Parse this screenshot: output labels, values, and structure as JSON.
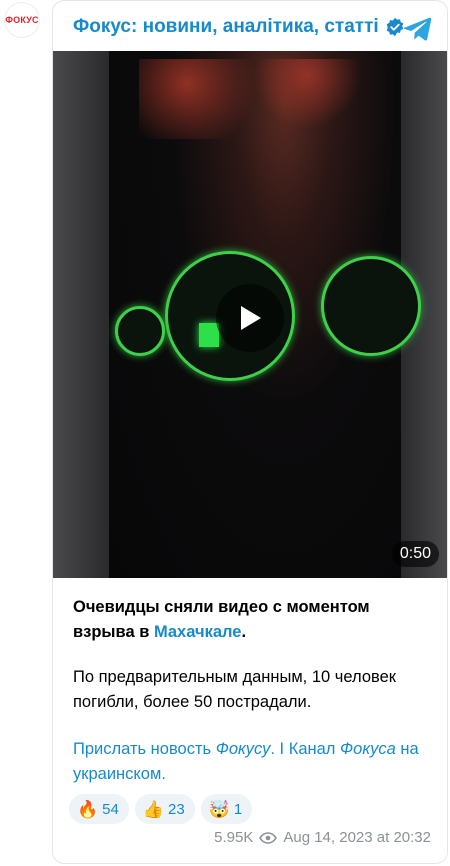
{
  "avatar": {
    "logo_text": "ФОКУС"
  },
  "header": {
    "title": "Фокус: новини, аналітика, статті",
    "verified_icon": "verified-badge-icon",
    "telegram_icon": "telegram-icon"
  },
  "video": {
    "duration": "0:50",
    "play_icon": "play-icon"
  },
  "message": {
    "headline_part1": "Очевидцы сняли видео с моментом взрыва в ",
    "headline_link": "Махачкале",
    "headline_end": ".",
    "body": "По предварительным данным, 10 человек погибли, более 50 пострадали.",
    "link1": "Прислать новость ",
    "link1_italic": "Фокусу",
    "link1_end": ".",
    "separator": " I ",
    "link2_part1": "Канал ",
    "link2_italic": "Фокуса",
    "link2_end": " на украинском."
  },
  "reactions": [
    {
      "emoji": "🔥",
      "count": "54"
    },
    {
      "emoji": "👍",
      "count": "23"
    },
    {
      "emoji": "🤯",
      "count": "1"
    }
  ],
  "footer": {
    "views": "5.95K",
    "date": "Aug 14, 2023 at 20:32"
  },
  "colors": {
    "accent": "#168acd",
    "meta": "#8a9297",
    "reaction_bg": "#eef3f8"
  }
}
